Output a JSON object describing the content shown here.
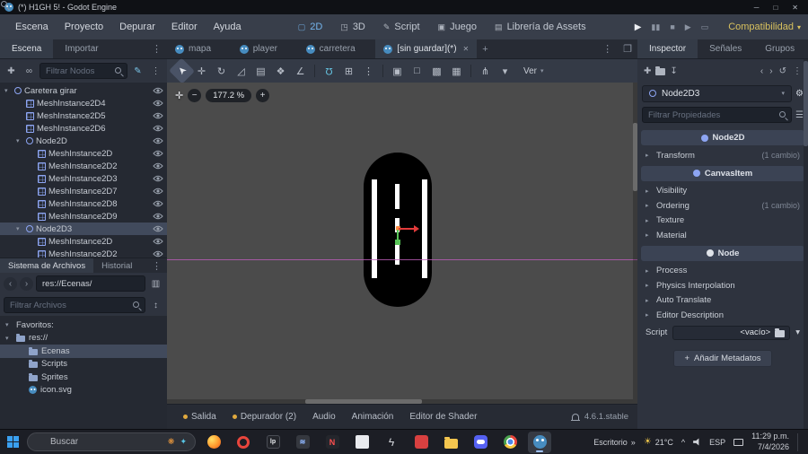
{
  "window": {
    "title": "(*) H1GH 5! - Godot Engine",
    "minimize": "─",
    "maximize": "□",
    "close": "✕"
  },
  "menubar": {
    "menus": [
      {
        "name": "menu-escena",
        "label": "Escena"
      },
      {
        "name": "menu-proyecto",
        "label": "Proyecto"
      },
      {
        "name": "menu-depurar",
        "label": "Depurar"
      },
      {
        "name": "menu-editor",
        "label": "Editor"
      },
      {
        "name": "menu-ayuda",
        "label": "Ayuda"
      }
    ],
    "workspaces": [
      {
        "name": "workspace-2d",
        "label": "2D",
        "glyph": "▢",
        "active": true
      },
      {
        "name": "workspace-3d",
        "label": "3D",
        "glyph": "◳"
      },
      {
        "name": "workspace-script",
        "label": "Script",
        "glyph": "✎"
      },
      {
        "name": "workspace-juego",
        "label": "Juego",
        "glyph": "▣"
      },
      {
        "name": "workspace-assetlib",
        "label": "Librería de Assets",
        "glyph": "▤"
      }
    ],
    "run_controls": [
      {
        "name": "play-button",
        "glyph": "▶",
        "bright": true
      },
      {
        "name": "pause-button",
        "glyph": "▮▮"
      },
      {
        "name": "stop-button",
        "glyph": "■"
      },
      {
        "name": "play-scene-button",
        "glyph": "▶"
      },
      {
        "name": "movie-mode-button",
        "glyph": "▭"
      }
    ],
    "renderer": {
      "label": "Compatibilidad",
      "chevron": "▾"
    }
  },
  "dock_left": {
    "tabs": [
      {
        "name": "tab-escena",
        "label": "Escena",
        "active": true
      },
      {
        "name": "tab-importar",
        "label": "Importar"
      }
    ],
    "more_glyph": "⋮",
    "toolbar": {
      "add_glyph": "✚",
      "instance_glyph": "∞",
      "script_glyph": "✎",
      "more_glyph": "⋮"
    },
    "filter_placeholder": "Filtrar Nodos",
    "tree": [
      {
        "label": "Caretera girar",
        "depth": 0,
        "icon": "node2d",
        "expandable": true,
        "eye": true
      },
      {
        "label": "MeshInstance2D4",
        "depth": 1,
        "icon": "mesh",
        "eye": true
      },
      {
        "label": "MeshInstance2D5",
        "depth": 1,
        "icon": "mesh",
        "eye": true
      },
      {
        "label": "MeshInstance2D6",
        "depth": 1,
        "icon": "mesh",
        "eye": true
      },
      {
        "label": "Node2D",
        "depth": 1,
        "icon": "node2d",
        "expandable": true,
        "eye": true
      },
      {
        "label": "MeshInstance2D",
        "depth": 2,
        "icon": "mesh",
        "eye": true
      },
      {
        "label": "MeshInstance2D2",
        "depth": 2,
        "icon": "mesh",
        "eye": true
      },
      {
        "label": "MeshInstance2D3",
        "depth": 2,
        "icon": "mesh",
        "eye": true
      },
      {
        "label": "MeshInstance2D7",
        "depth": 2,
        "icon": "mesh",
        "eye": true
      },
      {
        "label": "MeshInstance2D8",
        "depth": 2,
        "icon": "mesh",
        "eye": true
      },
      {
        "label": "MeshInstance2D9",
        "depth": 2,
        "icon": "mesh",
        "eye": true
      },
      {
        "label": "Node2D3",
        "depth": 1,
        "icon": "node2d",
        "expandable": true,
        "eye": true,
        "selected": true
      },
      {
        "label": "MeshInstance2D",
        "depth": 2,
        "icon": "mesh",
        "eye": true
      },
      {
        "label": "MeshInstance2D2",
        "depth": 2,
        "icon": "mesh",
        "eye": true
      }
    ]
  },
  "filesystem": {
    "tabs": [
      {
        "name": "tab-sistema-de-archivos",
        "label": "Sistema de Archivos",
        "active": true
      },
      {
        "name": "tab-historial",
        "label": "Historial"
      }
    ],
    "more_glyph": "⋮",
    "back_glyph": "‹",
    "forward_glyph": "›",
    "path": "res://Ecenas/",
    "split_glyph": "▥",
    "filter_placeholder": "Filtrar Archivos",
    "sort_glyph": "↕",
    "items": [
      {
        "label": "Favoritos:",
        "depth": 0,
        "icon": "none",
        "arrow": true
      },
      {
        "label": "res://",
        "depth": 0,
        "icon": "folder",
        "arrow": true
      },
      {
        "label": "Ecenas",
        "depth": 1,
        "icon": "folder",
        "selected": true
      },
      {
        "label": "Scripts",
        "depth": 1,
        "icon": "folder"
      },
      {
        "label": "Sprites",
        "depth": 1,
        "icon": "folder"
      },
      {
        "label": "icon.svg",
        "depth": 1,
        "icon": "godot"
      }
    ]
  },
  "scene_tabs": {
    "tabs": [
      {
        "name": "scene-tab-mapa",
        "label": "mapa"
      },
      {
        "name": "scene-tab-player",
        "label": "player"
      },
      {
        "name": "scene-tab-carretera",
        "label": "carretera"
      },
      {
        "name": "scene-tab-sin-guardar",
        "label": "[sin guardar](*)",
        "active": true,
        "closable": true
      }
    ],
    "close_glyph": "✕",
    "add_glyph": "+",
    "menu_glyph": "⋮",
    "float_glyph": "❐"
  },
  "viewport": {
    "tools": [
      {
        "name": "select-tool-icon",
        "glyph": "➤",
        "active": true,
        "rot": true
      },
      {
        "name": "move-tool-icon",
        "glyph": "✛"
      },
      {
        "name": "rotate-tool-icon",
        "glyph": "↻"
      },
      {
        "name": "scale-tool-icon",
        "glyph": "◿"
      },
      {
        "name": "list-select-tool-icon",
        "glyph": "▤"
      },
      {
        "name": "pan-tool-icon",
        "glyph": "❖"
      },
      {
        "name": "ruler-tool-icon",
        "glyph": "∠"
      },
      {
        "sep": true
      },
      {
        "name": "smart-snap-icon",
        "glyph": "Ω",
        "accent": true,
        "flip": true
      },
      {
        "name": "grid-snap-icon",
        "glyph": "⊞"
      },
      {
        "name": "snap-options-icon",
        "glyph": "⋮"
      },
      {
        "sep": true
      },
      {
        "name": "lock-icon",
        "glyph": "▣"
      },
      {
        "name": "unlock-icon",
        "glyph": "□"
      },
      {
        "name": "group-icon",
        "glyph": "▩"
      },
      {
        "name": "ungroup-icon",
        "glyph": "▦"
      },
      {
        "sep": true
      },
      {
        "name": "skeleton-icon",
        "glyph": "⋔"
      },
      {
        "name": "skeleton-options-icon",
        "glyph": "▾"
      }
    ],
    "ver_label": "Ver",
    "ver_chevron": "▾",
    "zoom": {
      "center": "✛",
      "out": "−",
      "value": "177.2 %",
      "in": "+"
    }
  },
  "bottom_bar": {
    "items": [
      {
        "name": "panel-salida",
        "label": "Salida",
        "dot": true
      },
      {
        "name": "panel-depurador",
        "label": "Depurador (2)",
        "dot": true
      },
      {
        "name": "panel-audio",
        "label": "Audio"
      },
      {
        "name": "panel-animacion",
        "label": "Animación"
      },
      {
        "name": "panel-editor-de-shader",
        "label": "Editor de Shader"
      }
    ],
    "version": "4.6.1.stable"
  },
  "inspector": {
    "tabs": [
      {
        "name": "tab-inspector",
        "label": "Inspector",
        "active": true
      },
      {
        "name": "tab-senales",
        "label": "Señales"
      },
      {
        "name": "tab-grupos",
        "label": "Grupos"
      }
    ],
    "toolbar": {
      "new_glyph": "✚",
      "save_glyph": "↧",
      "back_glyph": "‹",
      "forward_glyph": "›",
      "history_glyph": "↺",
      "more_glyph": "⋮"
    },
    "node": {
      "name": "Node2D3",
      "chevron": "▾",
      "gear": "⚙"
    },
    "filter_placeholder": "Filtrar Propiedades",
    "filter_more": "☰",
    "rows": [
      {
        "name": "category-node2d",
        "type": "category",
        "label": "Node2D",
        "icon_color": "#8da5f3"
      },
      {
        "name": "section-transform",
        "type": "section",
        "label": "Transform",
        "badge": "(1 cambio)"
      },
      {
        "name": "category-canvasitem",
        "type": "category",
        "label": "CanvasItem",
        "icon_color": "#8da5f3"
      },
      {
        "name": "section-visibility",
        "type": "section",
        "label": "Visibility"
      },
      {
        "name": "section-ordering",
        "type": "section",
        "label": "Ordering",
        "badge": "(1 cambio)"
      },
      {
        "name": "section-texture",
        "type": "section",
        "label": "Texture"
      },
      {
        "name": "section-material",
        "type": "section",
        "label": "Material"
      },
      {
        "name": "category-node",
        "type": "category",
        "label": "Node",
        "icon_color": "#dfe3e9"
      },
      {
        "name": "section-process",
        "type": "section",
        "label": "Process"
      },
      {
        "name": "section-physics-interpolation",
        "type": "section",
        "label": "Physics Interpolation"
      },
      {
        "name": "section-auto-translate",
        "type": "section",
        "label": "Auto Translate"
      },
      {
        "name": "section-editor-description",
        "type": "section",
        "label": "Editor Description"
      }
    ],
    "script": {
      "label": "Script",
      "value": "<vacío>",
      "chevron": "▾"
    },
    "add_metadata": {
      "plus": "+",
      "label": "Añadir Metadatos"
    }
  },
  "taskbar": {
    "search": {
      "placeholder_text": "Buscar",
      "deco": [
        {
          "name": "search-highlight-icon",
          "glyph": "❋",
          "color": "#f59e3d"
        },
        {
          "name": "search-sparkle-icon",
          "glyph": "✦",
          "color": "#58c7e8"
        }
      ]
    },
    "apps": [
      {
        "name": "taskbar-app-browser",
        "kind": "firefox"
      },
      {
        "name": "taskbar-app-opera",
        "kind": "opera"
      },
      {
        "name": "taskbar-app-lp",
        "kind": "lp",
        "text": "lp"
      },
      {
        "name": "taskbar-app-editor",
        "kind": "darkapp",
        "text": "≋"
      },
      {
        "name": "taskbar-app-notepad",
        "kind": "napp",
        "text": "N"
      },
      {
        "name": "taskbar-app-docs",
        "kind": "page"
      },
      {
        "name": "taskbar-app-tool",
        "kind": "bolt",
        "text": "ϟ"
      },
      {
        "name": "taskbar-app-red",
        "kind": "redapp"
      },
      {
        "name": "taskbar-app-explorer",
        "kind": "folderapp"
      },
      {
        "name": "taskbar-app-discord",
        "kind": "discord"
      },
      {
        "name": "taskbar-app-chrome",
        "kind": "chrome"
      },
      {
        "name": "taskbar-app-godot",
        "kind": "godotapp",
        "active": true
      }
    ],
    "tray": {
      "desktop_label": "Escritorio",
      "desktop_glyph": "»",
      "weather_glyph": "☀",
      "temp": "21°C",
      "chevron": "^",
      "lang": "ESP",
      "time": "11:29 p.m.",
      "date": "7/4/2026"
    }
  }
}
